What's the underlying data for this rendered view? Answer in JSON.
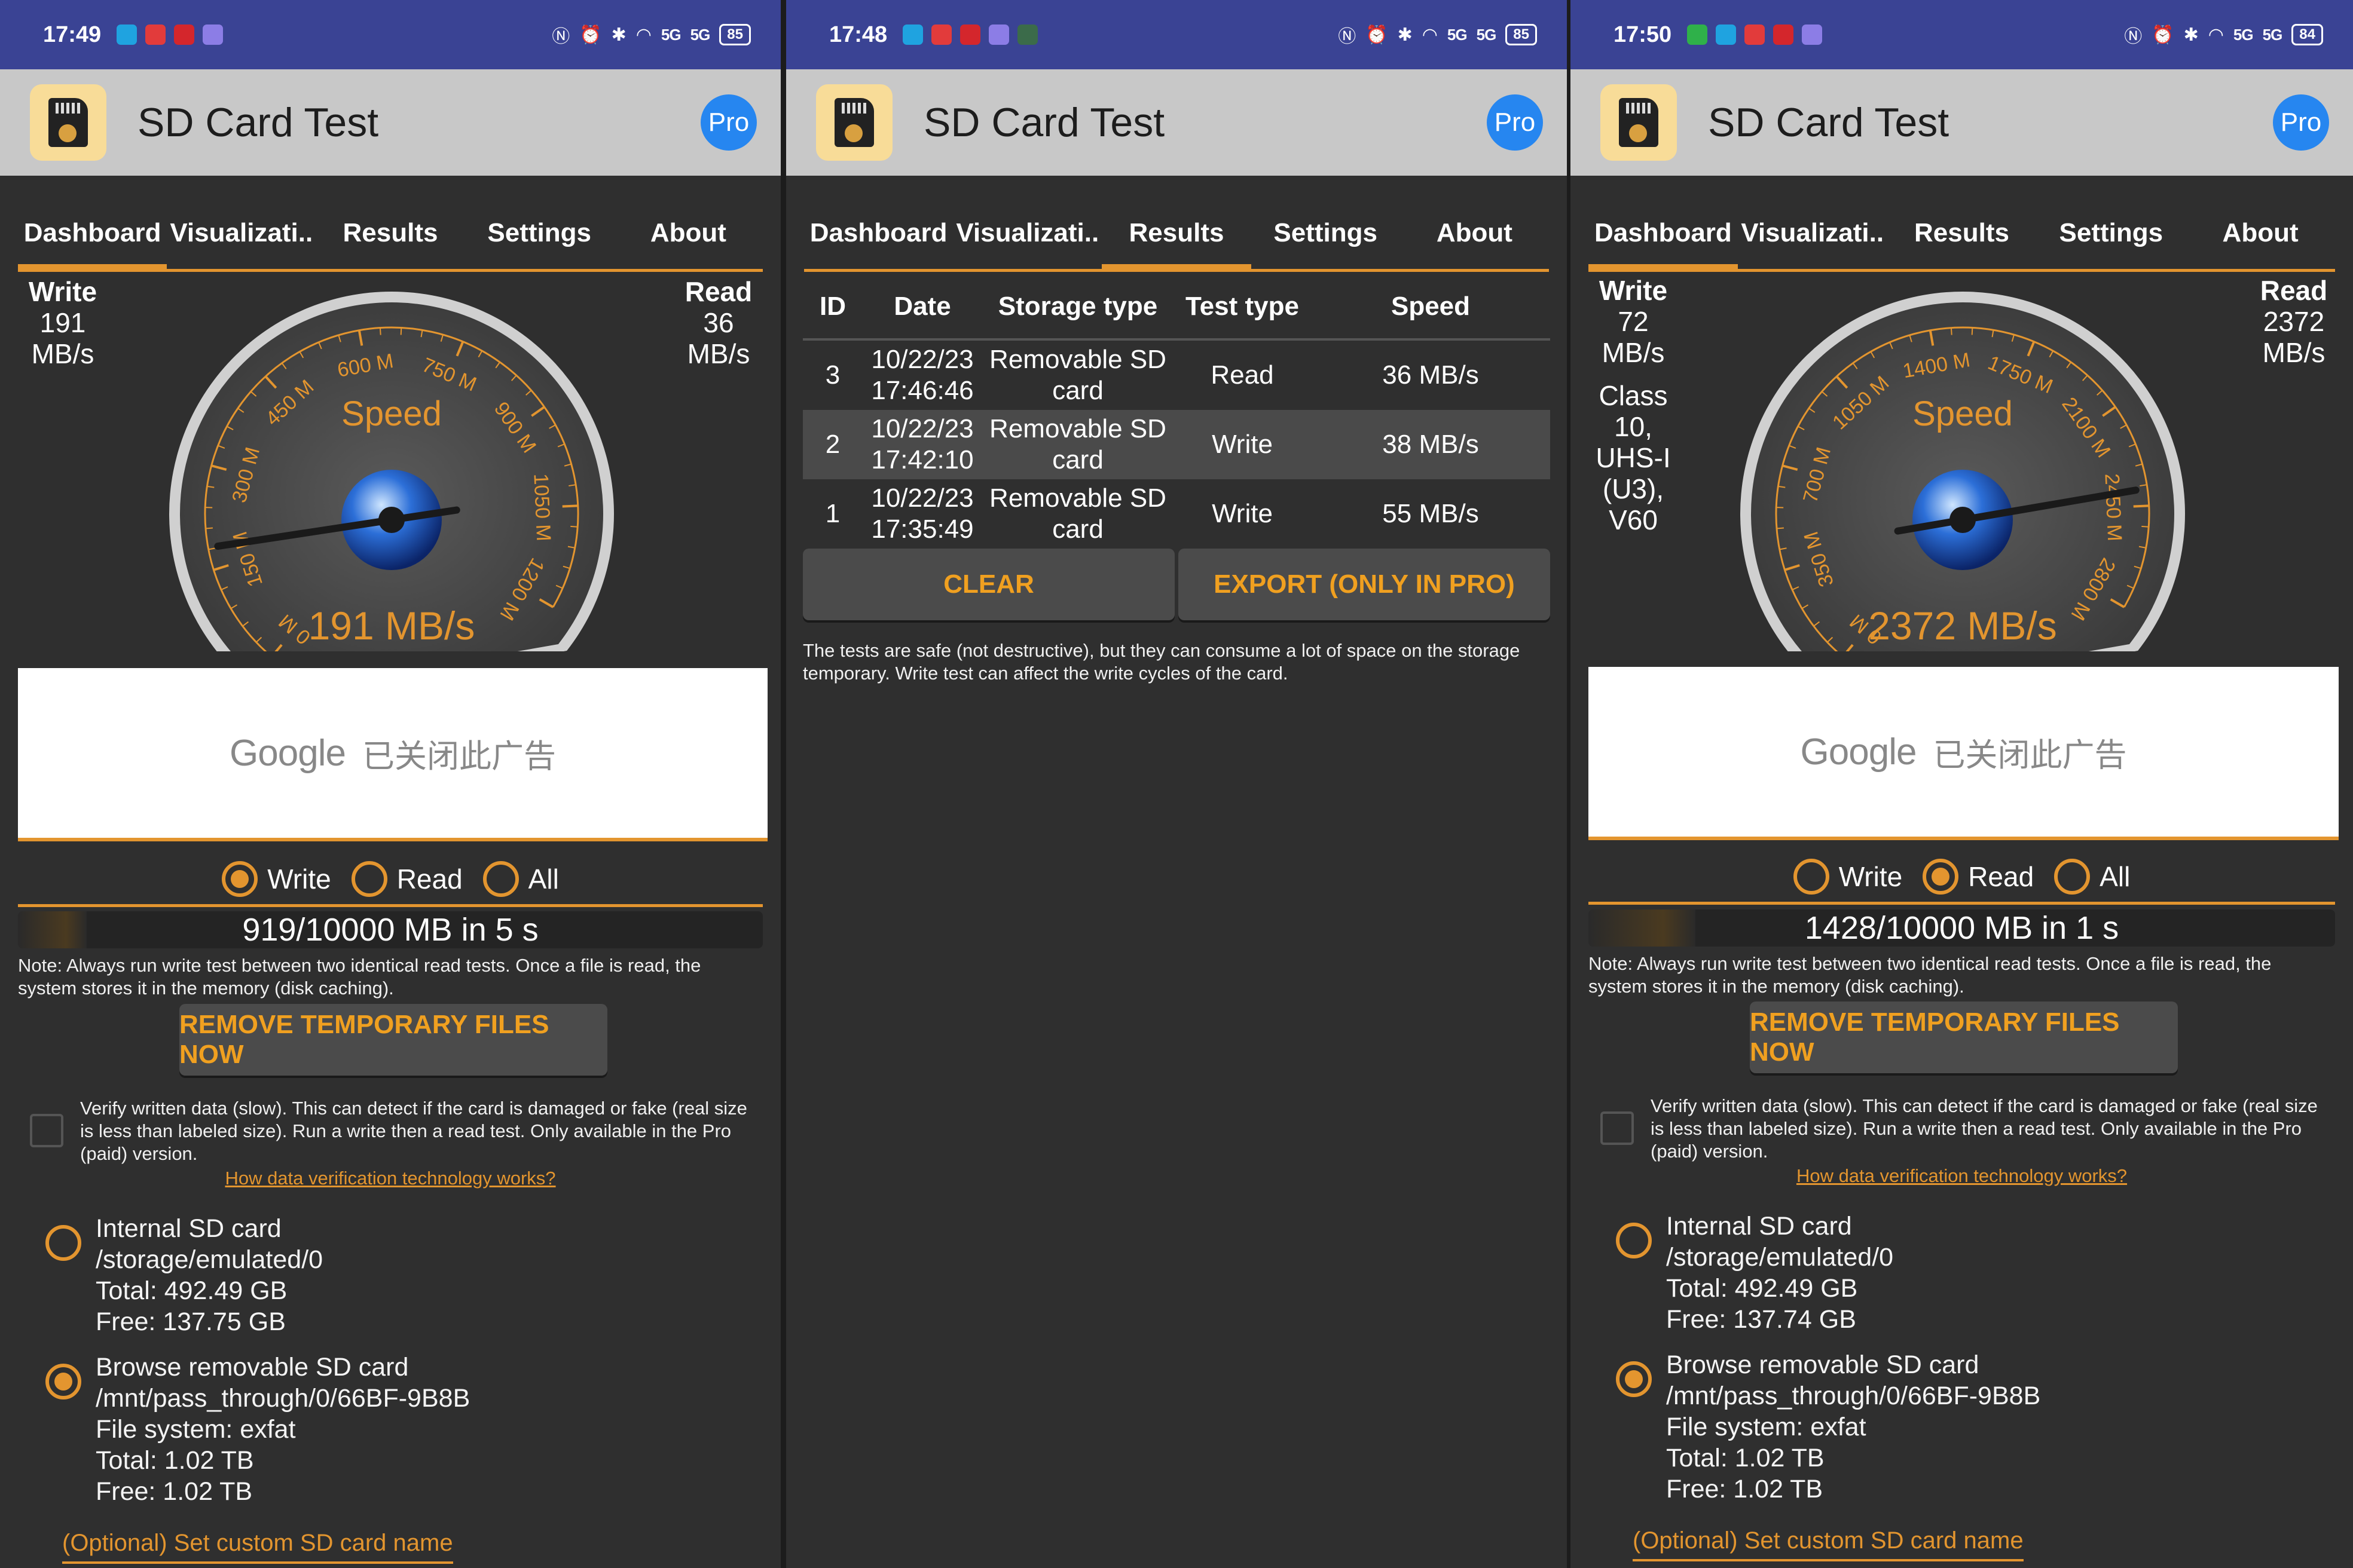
{
  "app": {
    "title": "SD Card Test",
    "pro_label": "Pro"
  },
  "tabs": [
    "Dashboard",
    "Visualizati..",
    "Results",
    "Settings",
    "About"
  ],
  "colors": {
    "accent": "#e3952f",
    "status_bar": "#3a4394",
    "app_bar": "#c8c8c8",
    "pro": "#2686f0"
  },
  "panels": [
    {
      "status": {
        "time": "17:49",
        "battery": "85",
        "sig": "5G"
      },
      "dashboard": {
        "write_label": "Write",
        "write_value": "191 MB/s",
        "read_label": "Read",
        "read_value": "36 MB/s",
        "card_info": "",
        "gauge": {
          "title": "Speed",
          "readout": "191 MB/s",
          "ticks": [
            "0 M",
            "150 M",
            "300 M",
            "450 M",
            "600 M",
            "750 M",
            "900 M",
            "1050 M",
            "1200 M"
          ],
          "max": 1200,
          "value": 191
        },
        "ad": {
          "brand": "Google",
          "message": "已关闭此广告"
        },
        "radios": [
          {
            "label": "Write",
            "on": true
          },
          {
            "label": "Read",
            "on": false
          },
          {
            "label": "All",
            "on": false
          }
        ],
        "progress": {
          "text": "919/10000 MB in 5 s",
          "fraction": 0.092
        },
        "note": "Note: Always run write test between two identical read tests. Once a file is read, the system stores it in the memory (disk caching).",
        "remove_btn": "REMOVE TEMPORARY FILES NOW",
        "verify_text": "Verify written data (slow). This can detect if the card is damaged or fake (real size is less than labeled size). Run a write then a read test. Only available in the Pro (paid) version.",
        "verify_link": "How data verification technology works?",
        "internal": {
          "name": "Internal SD card",
          "path": "/storage/emulated/0",
          "total": "Total: 492.49 GB",
          "free": "Free: 137.75 GB"
        },
        "removable": {
          "name": "Browse removable SD card",
          "path": "/mnt/pass_through/0/66BF-9B8B",
          "fs": "File system: exfat",
          "total": "Total: 1.02 TB",
          "free": "Free: 1.02 TB"
        },
        "custom_name": "(Optional) Set custom SD card name"
      }
    },
    {
      "status": {
        "time": "17:48",
        "battery": "85",
        "sig": "5G"
      },
      "results": {
        "headers": [
          "ID",
          "Date",
          "Storage type",
          "Test type",
          "Speed"
        ],
        "rows": [
          {
            "id": "3",
            "date": "10/22/23 17:46:46",
            "storage": "Removable SD card",
            "test": "Read",
            "speed": "36 MB/s"
          },
          {
            "id": "2",
            "date": "10/22/23 17:42:10",
            "storage": "Removable SD card",
            "test": "Write",
            "speed": "38 MB/s"
          },
          {
            "id": "1",
            "date": "10/22/23 17:35:49",
            "storage": "Removable SD card",
            "test": "Write",
            "speed": "55 MB/s"
          }
        ],
        "clear_btn": "CLEAR",
        "export_btn": "EXPORT (ONLY IN PRO)",
        "disclaimer": "The tests are safe (not destructive), but they can consume a lot of space on the storage temporary. Write test can affect the write cycles of the card."
      }
    },
    {
      "status": {
        "time": "17:50",
        "battery": "84",
        "sig": "5G"
      },
      "dashboard": {
        "write_label": "Write",
        "write_value": "72 MB/s",
        "read_label": "Read",
        "read_value": "2372 MB/s",
        "card_info": "Class 10, UHS-I (U3), V60",
        "gauge": {
          "title": "Speed",
          "readout": "2372 MB/s",
          "ticks": [
            "0 M",
            "350 M",
            "700 M",
            "1050 M",
            "1400 M",
            "1750 M",
            "2100 M",
            "2450 M",
            "2800 M"
          ],
          "max": 2800,
          "value": 2372
        },
        "ad": {
          "brand": "Google",
          "message": "已关闭此广告"
        },
        "radios": [
          {
            "label": "Write",
            "on": false
          },
          {
            "label": "Read",
            "on": true
          },
          {
            "label": "All",
            "on": false
          }
        ],
        "progress": {
          "text": "1428/10000 MB in 1 s",
          "fraction": 0.143
        },
        "note": "Note: Always run write test between two identical read tests. Once a file is read, the system stores it in the memory (disk caching).",
        "remove_btn": "REMOVE TEMPORARY FILES NOW",
        "verify_text": "Verify written data (slow). This can detect if the card is damaged or fake (real size is less than labeled size). Run a write then a read test. Only available in the Pro (paid) version.",
        "verify_link": "How data verification technology works?",
        "internal": {
          "name": "Internal SD card",
          "path": "/storage/emulated/0",
          "total": "Total: 492.49 GB",
          "free": "Free: 137.74 GB"
        },
        "removable": {
          "name": "Browse removable SD card",
          "path": "/mnt/pass_through/0/66BF-9B8B",
          "fs": "File system: exfat",
          "total": "Total: 1.02 TB",
          "free": "Free: 1.02 TB"
        },
        "custom_name": "(Optional) Set custom SD card name"
      }
    }
  ]
}
